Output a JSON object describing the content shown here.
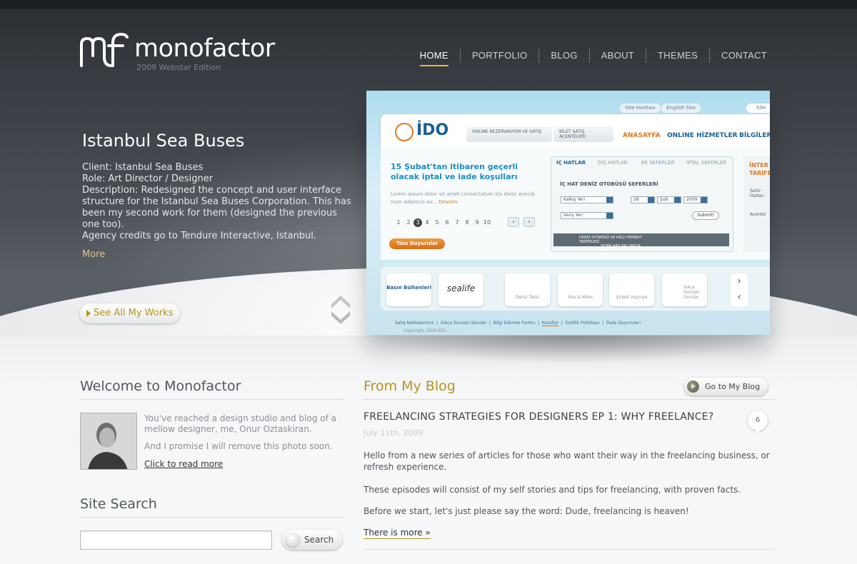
{
  "header": {
    "logo_mark": "mf",
    "logo_text": "monofactor",
    "logo_subtitle": "2009 Webstar Edition",
    "nav": [
      "HOME",
      "PORTFOLIO",
      "BLOG",
      "ABOUT",
      "THEMES",
      "CONTACT"
    ],
    "active_nav": "HOME",
    "accent_color": "#e8b93a"
  },
  "project": {
    "title": "Istanbul Sea Buses",
    "client": "Client: Istanbul Sea Buses",
    "role": "Role: Art Director / Designer",
    "description": "Description: Redesigned the concept and user interface structure for the Istanbul Sea Buses Corporation. This has been my second work for them (designed the previous one too).",
    "agency": "Agency credits go to Tendure Interactive, Istanbul.",
    "more_label": "More",
    "see_all_label": "See All My Works"
  },
  "screenshot": {
    "top_buttons": [
      "Site Haritası",
      "English Site"
    ],
    "search_placeholder": "Site",
    "logo": "İDO",
    "tabs": [
      "ONLINE REZERVASYON VE SATIŞ",
      "BİLET SATIŞ ACENTELERİ"
    ],
    "menu": [
      "ANASAYFA",
      "ONLINE HİZMETLER",
      "BİLGİLER"
    ],
    "headline": "15 Şubat'tan itibaren geçerli olacak iptal ve iade koşulları",
    "lorem": "Lorem ipsum dolor sit amet consectatum dis dolor avecid num adipiscis av...",
    "lorem_more": "Devamı",
    "pages": [
      "1",
      "2",
      "3",
      "4",
      "5",
      "6",
      "7",
      "8",
      "9",
      "10"
    ],
    "current_page": "3",
    "all_news": "Tüm Duyurular",
    "form_tabs": [
      "İÇ HATLAR",
      "DIŞ HATLAR",
      "EK SEFERLER",
      "İPTAL SEFERLER"
    ],
    "form_title": "İÇ HAT DENİZ OTOBÜSÜ SEFERLERİ",
    "from_label": "Kalkış Yeri",
    "to_label": "Varış Yeri",
    "day": "28",
    "month": "Şub",
    "year": "2009",
    "submit": "Submit!",
    "form_bar_left": "DENİZ OTOBÜSÜ VE HIZLI FERİBOT TARİFELERİ",
    "form_bar_right": "ŞEHİR HATLARI VAPUR TARİFELERİ",
    "side_title": "İNTER TARİFE",
    "side_items": [
      "Şehir Hatları",
      "Acentel"
    ],
    "tiles": [
      "Basın Bültenleri",
      "sealife",
      "Deniz Taksi",
      "Sea & Miles",
      "Şirketi Hayriye",
      "Sıkça Sorulan Sorular"
    ],
    "footer_links": [
      "Satış Noktalarımız",
      "Sıkça Sorulan Sorular",
      "Bilgi Edinme Formu",
      "Kurallar",
      "Gizlilik Politikası",
      "İhale Duyuruları"
    ],
    "copyright": "Copyright 2009 İDO"
  },
  "welcome": {
    "title": "Welcome to Monofactor",
    "text1": "You've reached a design studio and blog of a mellow designer, me, Onur Oztaskiran.",
    "text2": "And I promise I will remove this photo soon.",
    "read_more": "Click to read more"
  },
  "search": {
    "title": "Site Search",
    "value": "",
    "button": "Search"
  },
  "blog": {
    "title": "From My Blog",
    "goto_label": "Go to My Blog",
    "post_title": "FREELANCING STRATEGIES FOR DESIGNERS EP 1: WHY FREELANCE?",
    "post_date": "July 11th, 2009",
    "comments": "6",
    "paragraphs": [
      "Hello from a new series of articles for those who want their way in the freelancing business, or refresh experience.",
      "These episodes will consist of my self stories and tips for freelancing, with proven facts.",
      "Before we start, let's just please say the word: Dude, freelancing is heaven!"
    ],
    "there_is_more": "There is more »"
  }
}
